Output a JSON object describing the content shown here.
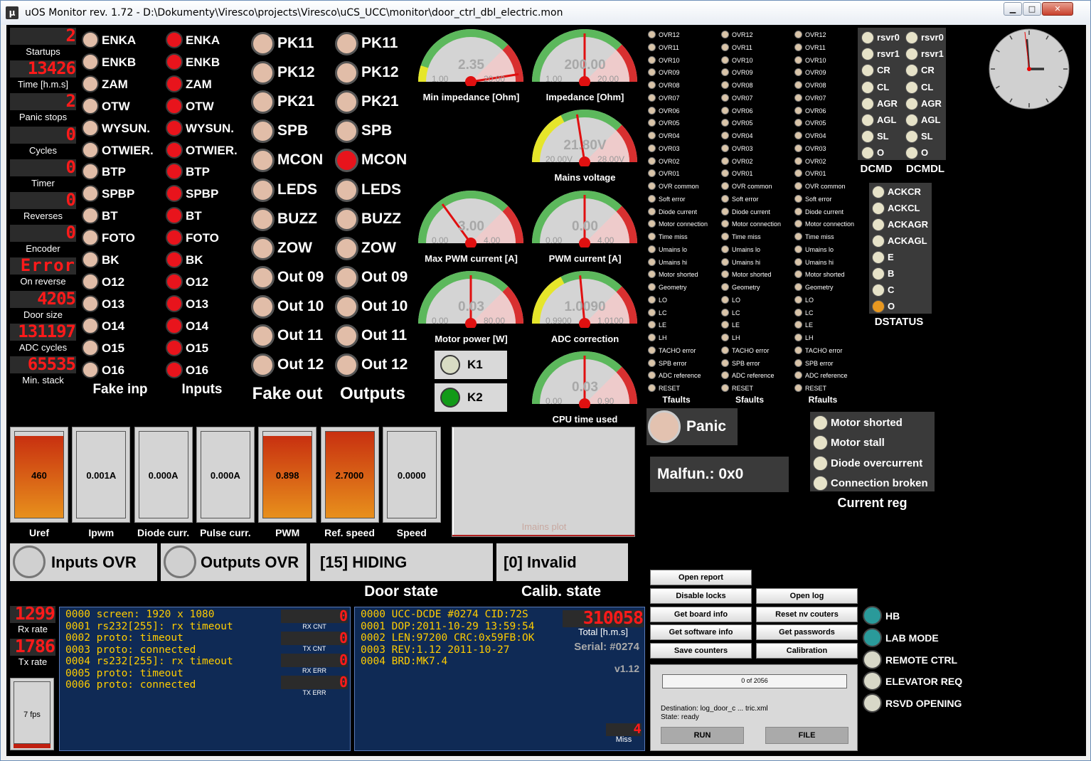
{
  "window": {
    "title": "uOS Monitor rev. 1.72 - D:\\Dokumenty\\Viresco\\projects\\Viresco\\uCS_UCC\\monitor\\door_ctrl_dbl_electric.mon",
    "icon_char": "µ",
    "btn_min": "▁",
    "btn_max": "□",
    "btn_close": "✕"
  },
  "counters": [
    {
      "label": "Startups",
      "value": "2"
    },
    {
      "label": "Time [h.m.s]",
      "value": "13426"
    },
    {
      "label": "Panic stops",
      "value": "2"
    },
    {
      "label": "Cycles",
      "value": "0"
    },
    {
      "label": "Timer",
      "value": "0"
    },
    {
      "label": "Reverses",
      "value": "0"
    },
    {
      "label": "Encoder",
      "value": "0"
    },
    {
      "label": "On reverse",
      "value": "Error"
    },
    {
      "label": "Door size",
      "value": "4205"
    },
    {
      "label": "ADC cycles",
      "value": "131197"
    },
    {
      "label": "Min. stack",
      "value": "65535"
    }
  ],
  "io_labels": [
    "ENKA",
    "ENKB",
    "ZAM",
    "OTW",
    "WYSUN.",
    "OTWIER.",
    "BTP",
    "SPBP",
    "BT",
    "FOTO",
    "BK",
    "O12",
    "O13",
    "O14",
    "O15",
    "O16"
  ],
  "fake_inp_title": "Fake inp",
  "inputs_title": "Inputs",
  "out_labels": [
    "PK11",
    "PK12",
    "PK21",
    "SPB",
    "MCON",
    "LEDS",
    "BUZZ",
    "ZOW",
    "Out 09",
    "Out 10",
    "Out 11",
    "Out 12"
  ],
  "fake_out_title": "Fake out",
  "outputs_title": "Outputs",
  "gauges": [
    {
      "label": "Min impedance [Ohm]",
      "value": "2.35",
      "min": "1.00",
      "max": "20.00"
    },
    {
      "label": "Impedance [Ohm]",
      "value": "200.00",
      "min": "1.00",
      "max": "20.00"
    },
    {
      "label": "Mains voltage",
      "value": "21.80V",
      "min": "20.00V",
      "max": "28.00V"
    },
    {
      "label": "Max PWM current [A]",
      "value": "3.00",
      "min": "0.00",
      "max": "4.00"
    },
    {
      "label": "PWM current [A]",
      "value": "0.00",
      "min": "0.00",
      "max": "4.00"
    },
    {
      "label": "Motor power [W]",
      "value": "0.03",
      "min": "0.00",
      "max": "80.00"
    },
    {
      "label": "ADC correction",
      "value": "1.0090",
      "min": "0.9900",
      "max": "1.0100"
    },
    {
      "label": "CPU time used",
      "value": "0.03",
      "min": "0.00",
      "max": "0.90"
    }
  ],
  "relays": [
    {
      "label": "K1"
    },
    {
      "label": "K2"
    }
  ],
  "fault_labels": [
    "OVR12",
    "OVR11",
    "OVR10",
    "OVR09",
    "OVR08",
    "OVR07",
    "OVR06",
    "OVR05",
    "OVR04",
    "OVR03",
    "OVR02",
    "OVR01",
    "OVR common",
    "Soft error",
    "Diode current",
    "Motor connection",
    "Time miss",
    "Umains lo",
    "Umains hi",
    "Motor shorted",
    "Geometry",
    "LO",
    "LC",
    "LE",
    "LH",
    "TACHO error",
    "SPB error",
    "ADC reference",
    "RESET"
  ],
  "fault_titles": [
    "Tfaults",
    "Sfaults",
    "Rfaults"
  ],
  "dcmd_labels": [
    "rsvr0",
    "rsvr1",
    "CR",
    "CL",
    "AGR",
    "AGL",
    "SL",
    "O"
  ],
  "dcmd_titles": [
    "DCMD",
    "DCMDL"
  ],
  "dstatus_labels": [
    "ACKCR",
    "ACKCL",
    "ACKAGR",
    "ACKAGL",
    "E",
    "B",
    "C",
    "O"
  ],
  "dstatus_title": "DSTATUS",
  "panic_label": "Panic",
  "malfun": "Malfun.: 0x0",
  "current_reg": {
    "title": "Current reg",
    "items": [
      "Motor shorted",
      "Motor stall",
      "Diode overcurrent",
      "Connection broken"
    ]
  },
  "bars": [
    {
      "label": "Uref",
      "value": "460",
      "fill": 0.95
    },
    {
      "label": "Ipwm",
      "value": "0.001A",
      "fill": 0
    },
    {
      "label": "Diode curr.",
      "value": "0.000A",
      "fill": 0
    },
    {
      "label": "Pulse curr.",
      "value": "0.000A",
      "fill": 0
    },
    {
      "label": "PWM",
      "value": "0.898",
      "fill": 0.95
    },
    {
      "label": "Ref. speed",
      "value": "2.7000",
      "fill": 1
    },
    {
      "label": "Speed",
      "value": "0.0000",
      "fill": 0
    }
  ],
  "plot_label": "Imains plot",
  "inputs_ovr": "Inputs OVR",
  "outputs_ovr": "Outputs OVR",
  "door_state": {
    "title": "Door state",
    "value": "[15] HIDING"
  },
  "calib_state": {
    "title": "Calib. state",
    "value": "[0] Invalid"
  },
  "rx_rate": {
    "label": "Rx rate",
    "value": "1299"
  },
  "tx_rate": {
    "label": "Tx rate",
    "value": "1786"
  },
  "fps": "7 fps",
  "log1": [
    "0000 screen: 1920 x 1080",
    "0001 rs232[255]: rx timeout",
    "0002 proto: timeout",
    "0003 proto: connected",
    "0004 rs232[255]: rx timeout",
    "0005 proto: timeout",
    "0006 proto: connected"
  ],
  "log1_counters": [
    {
      "label": "RX CNT",
      "value": "0"
    },
    {
      "label": "TX CNT",
      "value": "0"
    },
    {
      "label": "RX ERR",
      "value": "0"
    },
    {
      "label": "TX ERR",
      "value": "0"
    }
  ],
  "log2": [
    "0000 UCC-DCDE #0274 CID:72S",
    "0001 DOP:2011-10-29 13:59:54",
    "0002 LEN:97200 CRC:0x59FB:OK",
    "0003 REV:1.12 2011-10-27",
    "0004 BRD:MK7.4"
  ],
  "total": {
    "label": "Total [h.m.s]",
    "value": "310058"
  },
  "serial": "Serial: #0274",
  "version": "v1.12",
  "miss": {
    "label": "Miss",
    "value": "4"
  },
  "buttons": {
    "open_report": "Open report",
    "disable_locks": "Disable locks",
    "open_log": "Open log",
    "get_board": "Get board info",
    "reset_counters": "Reset nv couters",
    "get_sw": "Get software info",
    "get_pw": "Get passwords",
    "save_counters": "Save counters",
    "calibration": "Calibration"
  },
  "progress": {
    "text": "0 of 2056",
    "fill": 0,
    "dest": "Destination: log_door_c ... tric.xml",
    "state": "State: ready",
    "run": "RUN",
    "file": "FILE"
  },
  "status_leds": [
    {
      "label": "HB",
      "color": "#2a9a9a"
    },
    {
      "label": "LAB MODE",
      "color": "#2a9a9a"
    },
    {
      "label": "REMOTE CTRL",
      "color": "#d8d8c8"
    },
    {
      "label": "ELEVATOR REQ",
      "color": "#d8d8c8"
    },
    {
      "label": "RSVD OPENING",
      "color": "#d8d8c8"
    }
  ]
}
